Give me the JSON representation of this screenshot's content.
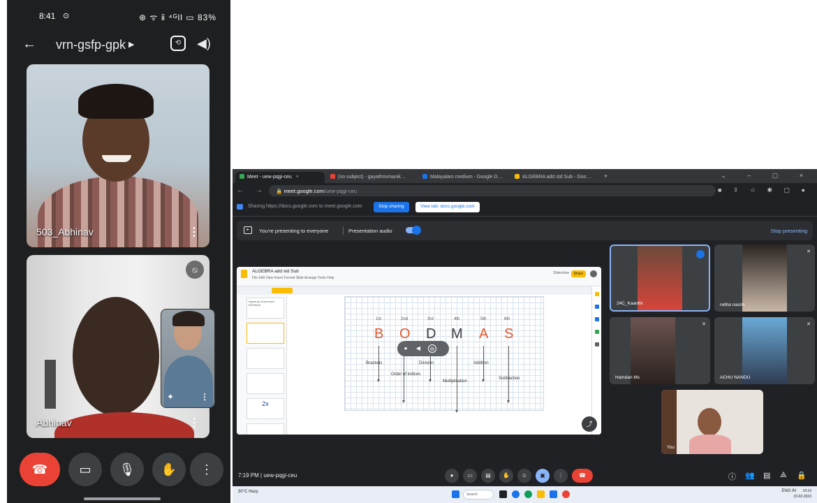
{
  "phone": {
    "status": {
      "time": "8:41",
      "time_icon": "⊙",
      "right": "⊛ ᯤ ⅱ ⁴ᴳll ▭ 83%"
    },
    "header": {
      "meeting_code": "vrn-gsfp-gpk"
    },
    "tiles": [
      {
        "name": "503_Abhinav"
      },
      {
        "name": "Abhinav"
      }
    ]
  },
  "browser": {
    "tabs": [
      {
        "label": "Meet - uew-pqgi-ceu",
        "color": "#34a853",
        "active": true
      },
      {
        "label": "(no subject) - gayathrivmanik…",
        "color": "#ea4335",
        "active": false
      },
      {
        "label": "Malayalam medium - Google D…",
        "color": "#1a73e8",
        "active": false
      },
      {
        "label": "ALGEBRA add std Sub - Goo…",
        "color": "#fbbc04",
        "active": false
      }
    ],
    "url_host": "meet.google.com",
    "url_path": "/uew-pqgi-ceu"
  },
  "sharebar": {
    "message": "Sharing https://docs.google.com to meet.google.com",
    "stop_label": "Stop sharing",
    "view_label": "View tab: docs.google.com"
  },
  "presenting": {
    "text": "You're presenting to everyone",
    "audio_label": "Presentation audio",
    "stop_label": "Stop presenting"
  },
  "slides": {
    "doc_title": "ALGEBRA add std Sub",
    "menu": "File  Edit  View  Insert  Format  Slide  Arrange  Tools  Help",
    "slideshow": "Slideshow",
    "share": "Share",
    "ordinals": [
      "1st",
      "2nd",
      "3rd",
      "4th",
      "5th",
      "6th"
    ],
    "letters": [
      "B",
      "O",
      "D",
      "M",
      "A",
      "S"
    ],
    "words": [
      "Brackets",
      "Order of indices",
      "Division",
      "Multiplication",
      "Addition",
      "Subtraction"
    ],
    "thumbs": [
      "Algebraic Expression BODMAS",
      "",
      "",
      "",
      "2x",
      ""
    ],
    "thumb_numbers": [
      "1",
      "2",
      "3",
      "4",
      "5",
      "6"
    ]
  },
  "participants": [
    {
      "name": "24C_Kaanthi"
    },
    {
      "name": "nidha nasrin"
    },
    {
      "name": "Hamdan Ms"
    },
    {
      "name": "ACHU NANDU"
    },
    {
      "name": "You"
    }
  ],
  "bottom": {
    "time_code": "7:19 PM  |  uew-pqgi-ceu"
  },
  "taskbar": {
    "weather": "30°C Hazy",
    "search": "Search",
    "tray": "ENG IN",
    "time": "19:19",
    "date": "23-02-2023"
  }
}
